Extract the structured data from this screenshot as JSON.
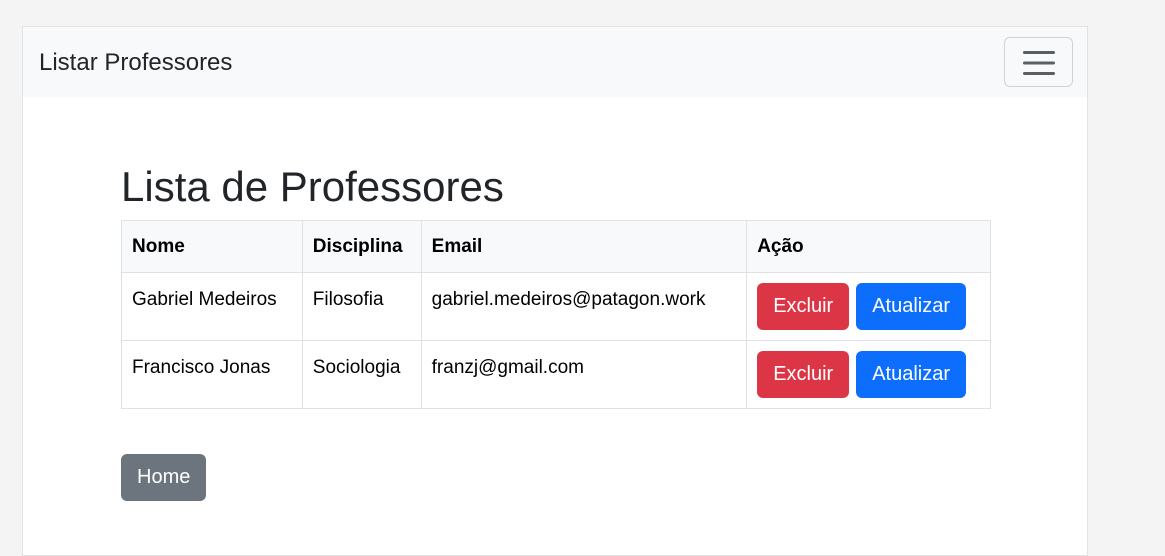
{
  "navbar": {
    "brand": "Listar Professores",
    "toggler_icon": "hamburger-menu-icon"
  },
  "main": {
    "title": "Lista de Professores",
    "table": {
      "headers": [
        "Nome",
        "Disciplina",
        "Email",
        "Ação"
      ],
      "rows": [
        {
          "nome": "Gabriel Medeiros",
          "disciplina": "Filosofia",
          "email": "gabriel.medeiros@patagon.work",
          "delete_label": "Excluir",
          "update_label": "Atualizar"
        },
        {
          "nome": "Francisco Jonas",
          "disciplina": "Sociologia",
          "email": "franzj@gmail.com",
          "delete_label": "Excluir",
          "update_label": "Atualizar"
        }
      ]
    },
    "home_label": "Home"
  },
  "colors": {
    "danger": "#dc3545",
    "primary": "#0d6efd",
    "secondary": "#6c757d",
    "navbar_bg": "#f8f9fa"
  }
}
